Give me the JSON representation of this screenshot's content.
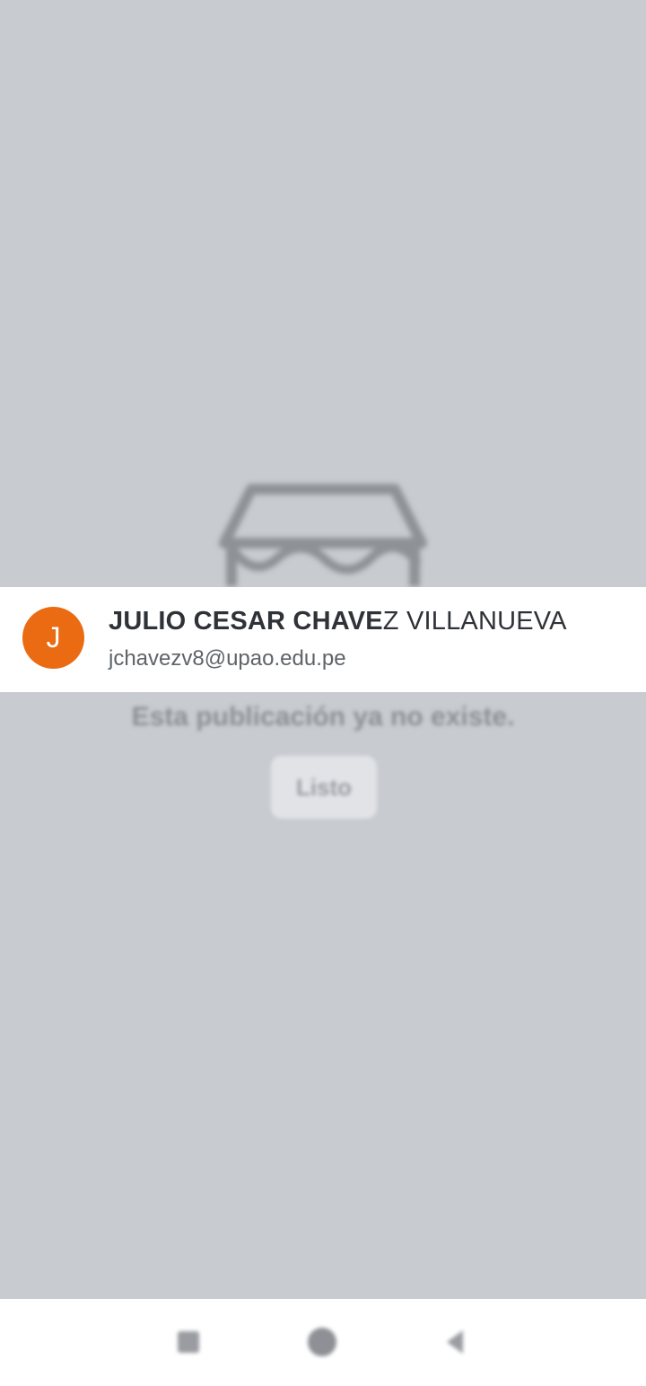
{
  "background": {
    "message": "Esta publicación ya no existe.",
    "ok_button_label": "Listo",
    "store_icon": "storefront-icon"
  },
  "account": {
    "avatar_initial": "J",
    "avatar_color": "#ea6b12",
    "name_bold": "JULIO CESAR CHAVE",
    "name_regular": "Z VILLANUEVA",
    "email": "jchavezv8@upao.edu.pe"
  },
  "nav_bar": {
    "recents_icon": "recents-icon",
    "home_icon": "home-icon",
    "back_icon": "back-icon"
  }
}
